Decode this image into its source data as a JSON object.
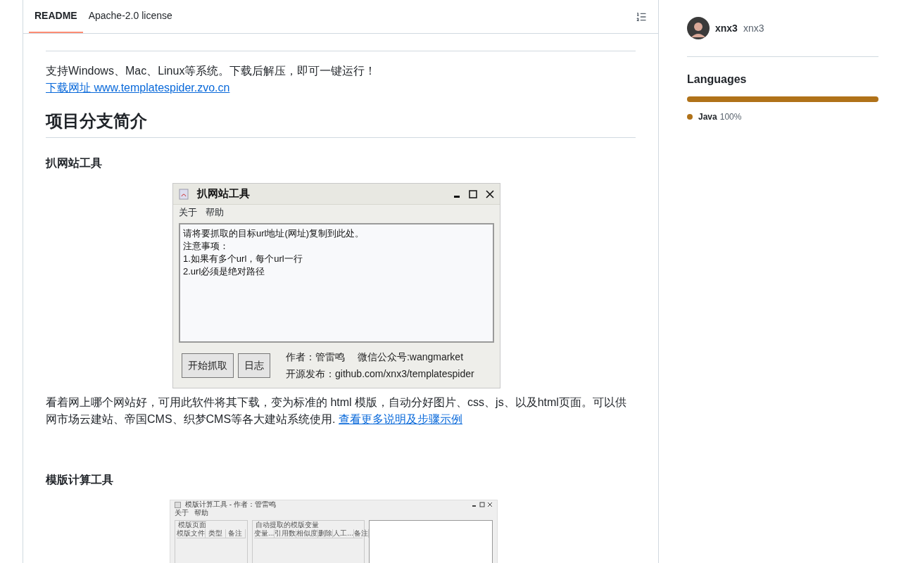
{
  "tabs": [
    {
      "label": "README",
      "selected": true
    },
    {
      "label": "Apache-2.0 license",
      "selected": false
    }
  ],
  "readme": {
    "download_text": "支持Windows、Mac、Linux等系统。下载后解压，即可一键运行！",
    "download_link": "下载网址 www.templatespider.zvo.cn",
    "section_heading": "项目分支简介",
    "tool1": {
      "heading": "扒网站工具",
      "window": {
        "title": "扒网站工具",
        "menu": [
          "关于",
          "帮助"
        ],
        "textarea_lines": [
          "请将要抓取的目标url地址(网址)复制到此处。",
          "注意事项：",
          "1.如果有多个url，每个url一行",
          "2.url必须是绝对路径"
        ],
        "buttons": [
          "开始抓取",
          "日志"
        ],
        "info_lines": [
          "作者：管雷鸣　 微信公众号:wangmarket",
          "开源发布：github.com/xnx3/templatespider"
        ]
      },
      "description": "看着网上哪个网站好，可用此软件将其下载，变为标准的 html 模版，自动分好图片、css、js、以及html页面。可以供网市场云建站、帝国CMS、织梦CMS等各大建站系统使用.",
      "more_link": "查看更多说明及步骤示例"
    },
    "tool2": {
      "heading": "模版计算工具",
      "window": {
        "title": "模版计算工具 - 作者：管雷鸣",
        "menu": [
          "关于",
          "帮助"
        ],
        "group1": {
          "title": "模版页面",
          "columns": [
            "模版文件",
            "类型",
            "备注"
          ]
        },
        "group2": {
          "title": "自动提取的模版变量",
          "columns": [
            "变量...",
            "引用数",
            "相似度",
            "删除",
            "人工...",
            "备注"
          ]
        }
      }
    }
  },
  "sidebar": {
    "contributors": {
      "people": [
        {
          "login": "xnx3",
          "name": "xnx3"
        }
      ]
    },
    "languages": {
      "title": "Languages",
      "items": [
        {
          "name": "Java",
          "percent": "100%",
          "color": "#b07219",
          "level": 1
        }
      ]
    }
  }
}
